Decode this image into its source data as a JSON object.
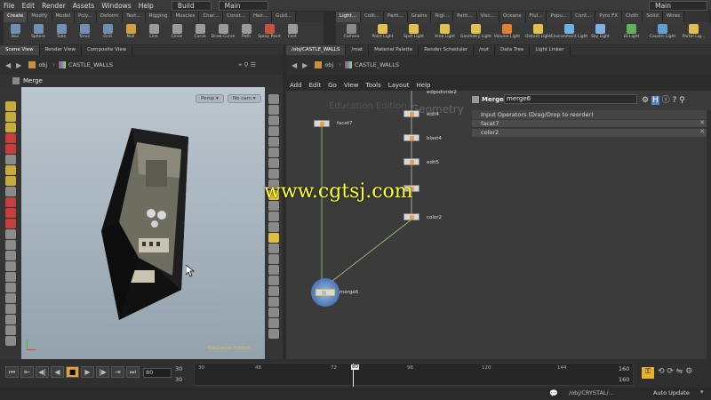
{
  "menubar": {
    "items": [
      "File",
      "Edit",
      "Render",
      "Assets",
      "Windows",
      "Help"
    ],
    "desktop": "Build",
    "desktop2": "Main",
    "right_desktop": "Main"
  },
  "shelf_tabs_left": [
    "Create",
    "Modify",
    "Model",
    "Poly...",
    "Deform",
    "Text...",
    "Rigging",
    "Muscles",
    "Char...",
    "Const...",
    "Hair...",
    "Guid..."
  ],
  "shelf_tabs_right": [
    "Light...",
    "Colli...",
    "Parti...",
    "Grains",
    "Rigi...",
    "Parti...",
    "Visc...",
    "Oceans",
    "Flui...",
    "Popu...",
    "Cont...",
    "Pyro FX",
    "Cloth",
    "Solid",
    "Wires"
  ],
  "shelf_tools_left": [
    {
      "label": "Box",
      "color": "#6f8fb3"
    },
    {
      "label": "Sphere",
      "color": "#6f8fb3"
    },
    {
      "label": "Tube",
      "color": "#6f8fb3"
    },
    {
      "label": "Torus",
      "color": "#6f8fb3"
    },
    {
      "label": "Grid",
      "color": "#6f8fb3"
    },
    {
      "label": "Null",
      "color": "#d0a040"
    },
    {
      "label": "Line",
      "color": "#9a9a9a"
    },
    {
      "label": "Circle",
      "color": "#9a9a9a"
    },
    {
      "label": "Curve",
      "color": "#9a9a9a"
    },
    {
      "label": "Draw Curve",
      "color": "#9a9a9a"
    },
    {
      "label": "Path",
      "color": "#9a9a9a"
    },
    {
      "label": "Spray Paint",
      "color": "#c85040"
    },
    {
      "label": "Font",
      "color": "#9a9a9a"
    }
  ],
  "shelf_tools_right": [
    {
      "label": "Camera",
      "color": "#8a8a8a"
    },
    {
      "label": "Point Light",
      "color": "#e0c050"
    },
    {
      "label": "Spot Light",
      "color": "#e0c050"
    },
    {
      "label": "Area Light",
      "color": "#e0c050"
    },
    {
      "label": "Geometry Light",
      "color": "#e0c050"
    },
    {
      "label": "Volume Light",
      "color": "#e08030"
    },
    {
      "label": "Distant Light",
      "color": "#e0c050"
    },
    {
      "label": "Environment Light",
      "color": "#6fb0e0"
    },
    {
      "label": "Sky Light",
      "color": "#7fb0e0"
    },
    {
      "label": "GI Light",
      "color": "#60b060"
    },
    {
      "label": "Caustic Light",
      "color": "#60a0d0"
    },
    {
      "label": "Portal Lig...",
      "color": "#e0c050"
    }
  ],
  "left_pane": {
    "tabs": [
      "Scene View",
      "Render View",
      "Composite View"
    ],
    "path_root": "obj",
    "path_node": "CASTLE_WALLS",
    "viewport_title": "Merge",
    "camera_dropdown": "Persp",
    "cam_dropdown": "No cam",
    "watermark": "Education Edition"
  },
  "right_pane": {
    "tabs": [
      "/obj/CASTLE_WALLS",
      "/mat",
      "Material Palette",
      "Render Scheduler",
      "/out",
      "Data Tree",
      "Light Linker"
    ],
    "path_root": "obj",
    "path_node": "CASTLE_WALLS",
    "menu": [
      "Add",
      "Edit",
      "Go",
      "View",
      "Tools",
      "Layout",
      "Help"
    ],
    "network_watermark": "Education Edition",
    "network_title_overlay": "Geometry",
    "nodes": [
      "facet7",
      "edit4",
      "blast4",
      "edit5",
      "color2",
      "merge6"
    ],
    "node_top_partial": "edgedivide2"
  },
  "params": {
    "node_type": "Merge",
    "node_name": "merge6",
    "section_label": "Input Operators (Drag/Drop to reorder)",
    "inputs": [
      "facet7",
      "color2"
    ]
  },
  "overlay_url": "www.cgtsj.com",
  "timeline": {
    "current_frame": "80",
    "start_frame": "30",
    "start_frame2": "30",
    "end_frame": "160",
    "end_frame2": "160",
    "ticks": [
      "30",
      "48",
      "72",
      "80",
      "96",
      "120",
      "144"
    ]
  },
  "status": {
    "path": "/obj/CRYSTAL/...",
    "update_mode": "Auto Update"
  }
}
